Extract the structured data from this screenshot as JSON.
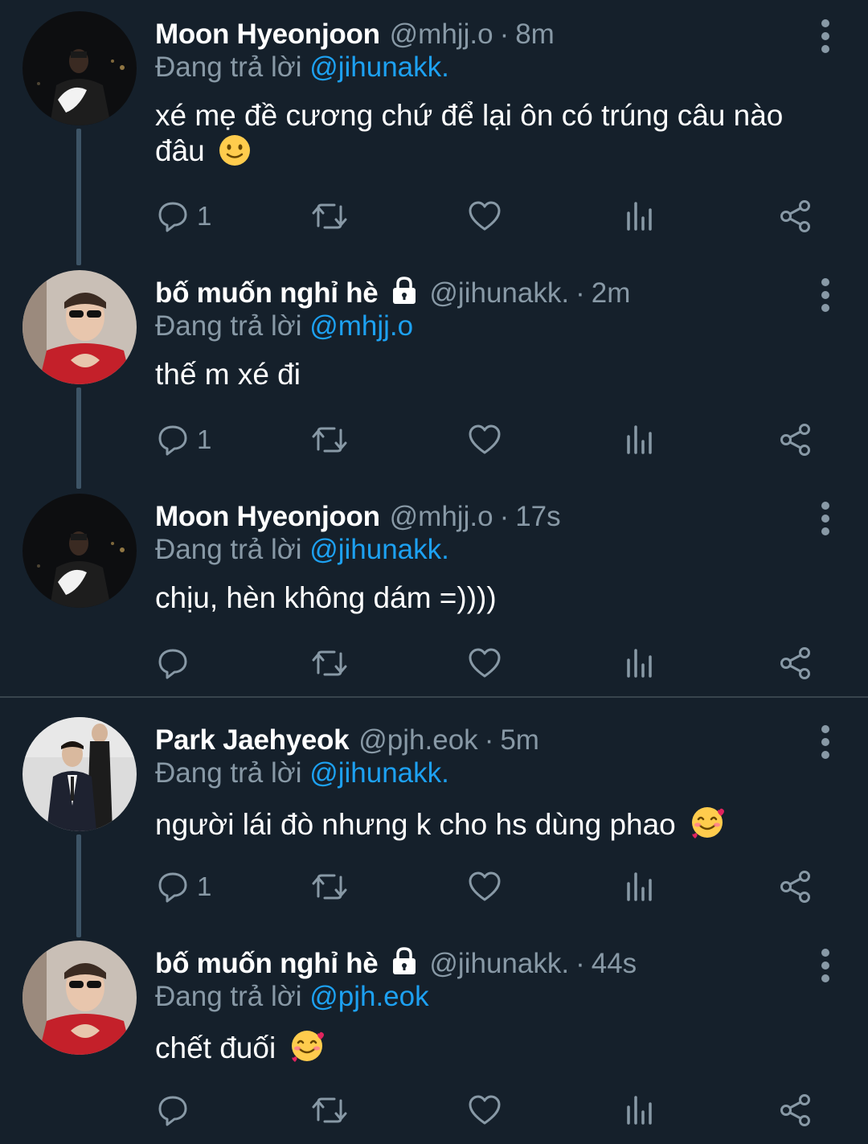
{
  "tweets": [
    {
      "name": "Moon Hyeonjoon",
      "locked": false,
      "handle": "@mhjj.o",
      "time": "8m",
      "replying_prefix": "Đang trả lời",
      "replying_to": "@jihunakk.",
      "text": "xé mẹ đề cương chứ để lại ôn có trúng câu nào đâu",
      "emoji": "slightly-smiling-face",
      "reply_count": "1"
    },
    {
      "name": "bố muốn nghỉ hè",
      "locked": true,
      "handle": "@jihunakk.",
      "time": "2m",
      "replying_prefix": "Đang trả lời",
      "replying_to": "@mhjj.o",
      "text": "thế m xé đi",
      "emoji": "",
      "reply_count": "1"
    },
    {
      "name": "Moon Hyeonjoon",
      "locked": false,
      "handle": "@mhjj.o",
      "time": "17s",
      "replying_prefix": "Đang trả lời",
      "replying_to": "@jihunakk.",
      "text": "chịu, hèn không dám =))))",
      "emoji": "",
      "reply_count": ""
    },
    {
      "name": "Park Jaehyeok",
      "locked": false,
      "handle": "@pjh.eok",
      "time": "5m",
      "replying_prefix": "Đang trả lời",
      "replying_to": "@jihunakk.",
      "text": "người lái đò nhưng k cho hs dùng phao",
      "emoji": "smiling-face-with-hearts",
      "reply_count": "1"
    },
    {
      "name": "bố muốn nghỉ hè",
      "locked": true,
      "handle": "@jihunakk.",
      "time": "44s",
      "replying_prefix": "Đang trả lời",
      "replying_to": "@pjh.eok",
      "text": "chết đuối",
      "emoji": "smiling-face-with-hearts",
      "reply_count": ""
    }
  ],
  "icons": [
    "reply-icon",
    "retweet-icon",
    "like-icon",
    "analytics-icon",
    "share-icon",
    "more-options-icon",
    "lock-icon"
  ],
  "colors": {
    "background": "#15202b",
    "text_primary": "#ffffff",
    "text_secondary": "#8899a6",
    "mention": "#1da1f2",
    "thread_line": "#3d5466",
    "divider": "#38444d"
  }
}
